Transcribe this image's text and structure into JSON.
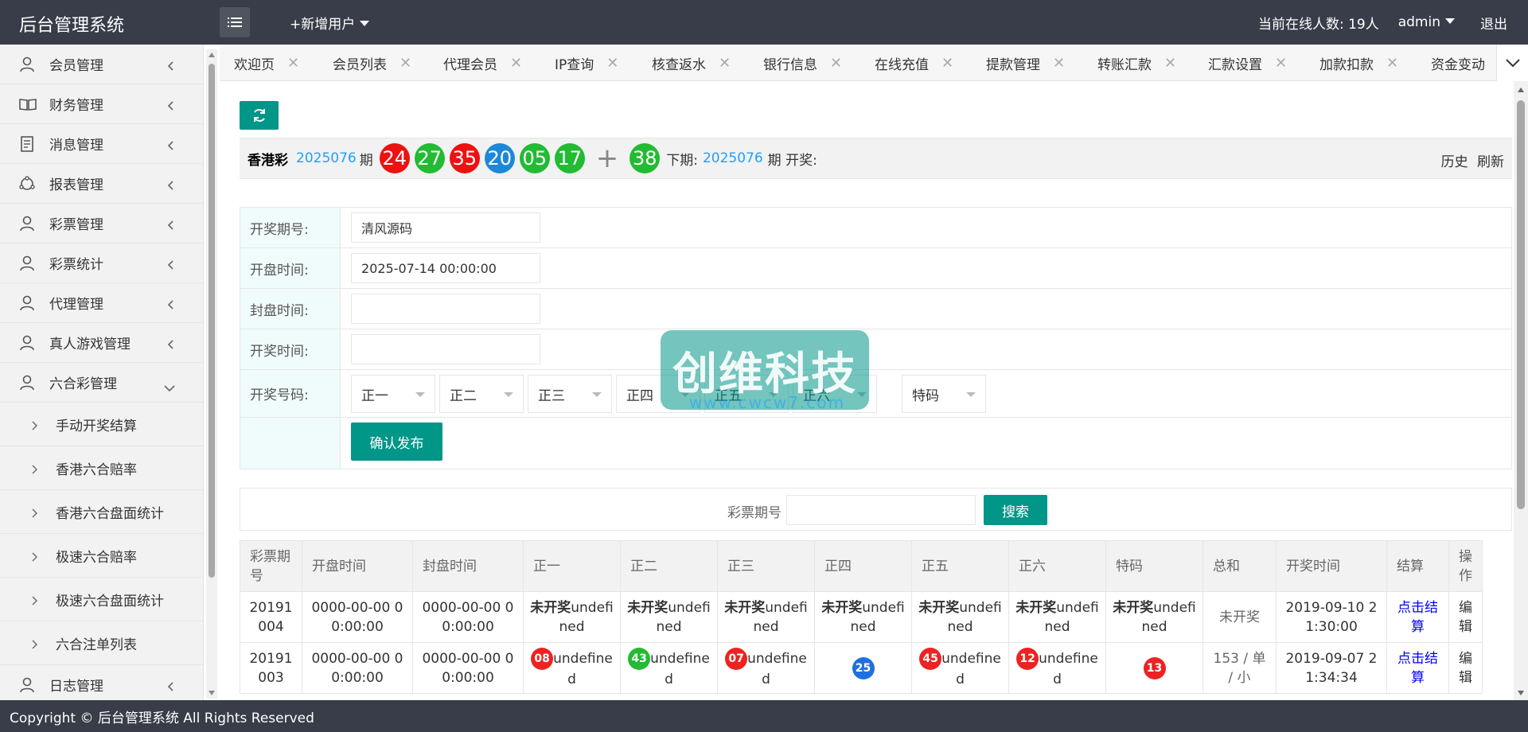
{
  "header": {
    "title": "后台管理系统",
    "add_user": "+新增用户",
    "online": "当前在线人数: 19人",
    "admin": "admin",
    "logout": "退出"
  },
  "sidebar": {
    "items": [
      {
        "label": "会员管理",
        "icon": "user-icon"
      },
      {
        "label": "财务管理",
        "icon": "book-icon"
      },
      {
        "label": "消息管理",
        "icon": "message-icon"
      },
      {
        "label": "报表管理",
        "icon": "report-icon"
      },
      {
        "label": "彩票管理",
        "icon": "user-icon"
      },
      {
        "label": "彩票统计",
        "icon": "user-icon"
      },
      {
        "label": "代理管理",
        "icon": "user-icon"
      },
      {
        "label": "真人游戏管理",
        "icon": "user-icon"
      },
      {
        "label": "六合彩管理",
        "icon": "user-icon"
      }
    ],
    "sub_items": [
      "手动开奖结算",
      "香港六合赔率",
      "香港六合盘面统计",
      "极速六合赔率",
      "极速六合盘面统计",
      "六合注单列表"
    ],
    "last_item": "日志管理"
  },
  "tabs": [
    "欢迎页",
    "会员列表",
    "代理会员",
    "IP查询",
    "核查返水",
    "银行信息",
    "在线充值",
    "提款管理",
    "转账汇款",
    "汇款设置",
    "加款扣款",
    "资金变动"
  ],
  "lottery": {
    "name": "香港彩",
    "period": "2025076",
    "period_suffix": "期",
    "balls": [
      {
        "num": "24",
        "color": "#ee1111"
      },
      {
        "num": "27",
        "color": "#22bb33"
      },
      {
        "num": "35",
        "color": "#ee1111"
      },
      {
        "num": "20",
        "color": "#1e88d8"
      },
      {
        "num": "05",
        "color": "#22bb33"
      },
      {
        "num": "17",
        "color": "#22bb33"
      }
    ],
    "special": {
      "num": "38",
      "color": "#22bb33"
    },
    "next_label": "下期:",
    "next_period": "2025076",
    "next_suffix": "期 开奖:",
    "history": "历史",
    "refresh": "刷新"
  },
  "form": {
    "period_label": "开奖期号:",
    "period_value": "清风源码",
    "open_label": "开盘时间:",
    "open_value": "2025-07-14 00:00:00",
    "close_label": "封盘时间:",
    "draw_label": "开奖时间:",
    "numbers_label": "开奖号码:",
    "selects": [
      "正一",
      "正二",
      "正三",
      "正四",
      "正五",
      "正六",
      "特码"
    ],
    "publish": "确认发布"
  },
  "search": {
    "label": "彩票期号",
    "button": "搜索"
  },
  "table": {
    "headers": [
      "彩票期号",
      "开盘时间",
      "封盘时间",
      "正一",
      "正二",
      "正三",
      "正四",
      "正五",
      "正六",
      "特码",
      "总和",
      "开奖时间",
      "结算",
      "操作"
    ],
    "row1": {
      "period": "20191004",
      "open": "0000-00-00 00:00:00",
      "close": "0000-00-00 00:00:00",
      "pending_bold": "未开奖",
      "pending_rest": "undefined",
      "sum": "未开奖",
      "draw_time": "2019-09-10 21:30:00",
      "settle": "点击结算",
      "op": "编辑"
    },
    "row2": {
      "period": "20191003",
      "open": "0000-00-00 00:00:00",
      "close": "0000-00-00 00:00:00",
      "balls": [
        {
          "num": "08",
          "color": "#ee2222",
          "suffix": "undefined"
        },
        {
          "num": "43",
          "color": "#22bb33",
          "suffix": "undefined"
        },
        {
          "num": "07",
          "color": "#ee2222",
          "suffix": "undefined"
        },
        {
          "num": "25",
          "color": "#1e70e0",
          "suffix": ""
        },
        {
          "num": "45",
          "color": "#ee2222",
          "suffix": "undefined"
        },
        {
          "num": "12",
          "color": "#ee2222",
          "suffix": "undefined"
        },
        {
          "num": "13",
          "color": "#ee2222",
          "suffix": ""
        }
      ],
      "sum": "153 / 单 / 小",
      "draw_time": "2019-09-07 21:34:34",
      "settle": "点击结算",
      "op": "编辑"
    }
  },
  "watermark": {
    "main": "创维科技",
    "sub": "www.cwcw7.com"
  },
  "footer": "Copyright © 后台管理系统 All Rights Reserved"
}
